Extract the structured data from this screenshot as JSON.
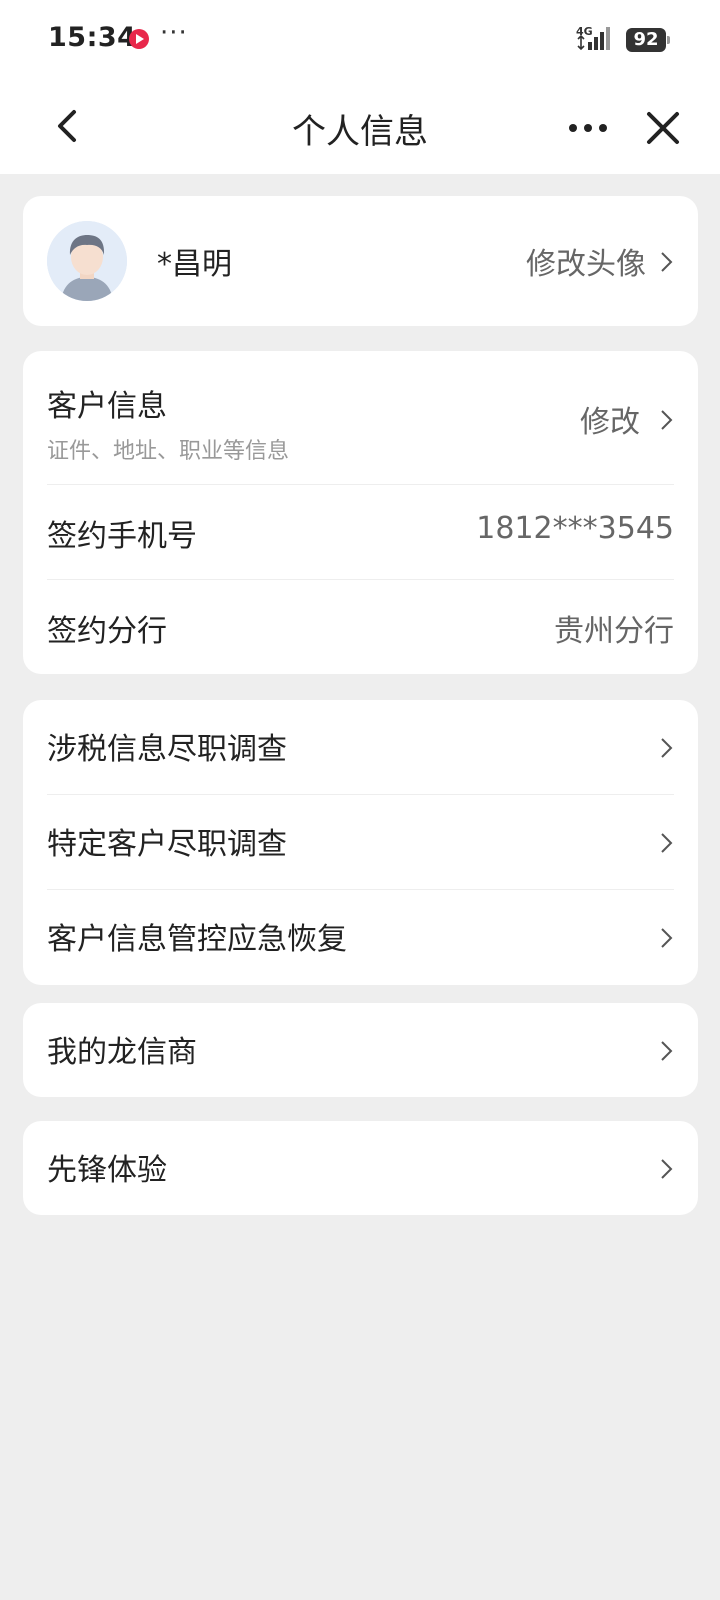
{
  "status_bar": {
    "time": "15:34",
    "network": "4G",
    "battery": "92",
    "icons": [
      "app-notification-icon",
      "more-dots-icon",
      "signal-icon",
      "battery-icon"
    ]
  },
  "navbar": {
    "title": "个人信息",
    "icons": [
      "back-chevron-icon",
      "more-icon",
      "close-icon"
    ]
  },
  "profile": {
    "name": "*昌明",
    "change_avatar": "修改头像"
  },
  "account": {
    "customer_info_label": "客户信息",
    "customer_info_sub": "证件、地址、职业等信息",
    "customer_info_action": "修改",
    "phone_label": "签约手机号",
    "phone_value": "1812***3545",
    "branch_label": "签约分行",
    "branch_value": "贵州分行"
  },
  "compliance": {
    "items": [
      {
        "label": "涉税信息尽职调查"
      },
      {
        "label": "特定客户尽职调查"
      },
      {
        "label": "客户信息管控应急恢复"
      }
    ]
  },
  "dealer": {
    "label": "我的龙信商"
  },
  "pioneer": {
    "label": "先锋体验"
  },
  "colors": {
    "background": "#eeeeee",
    "card": "#ffffff",
    "text_primary": "#222222",
    "text_secondary": "#666666",
    "text_hint": "#999999",
    "accent_red": "#e8284b"
  }
}
